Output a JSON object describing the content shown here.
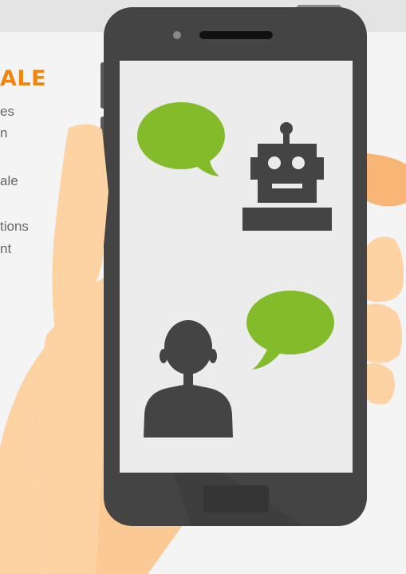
{
  "infographic": {
    "heading": "ALE",
    "body_lines": [
      "es",
      "n",
      "ale",
      "tions",
      "nt"
    ]
  },
  "colors": {
    "accent": "#f0860f",
    "phone_body": "#444444",
    "screen": "#ececec",
    "skin": "#fdd3a4",
    "bubble": "#83bb2a"
  },
  "icons": {
    "phone": "smartphone",
    "hand": "hand-holding-phone",
    "bot": "robot-icon",
    "user": "person-icon",
    "bubbles": "speech-bubble-icon"
  }
}
